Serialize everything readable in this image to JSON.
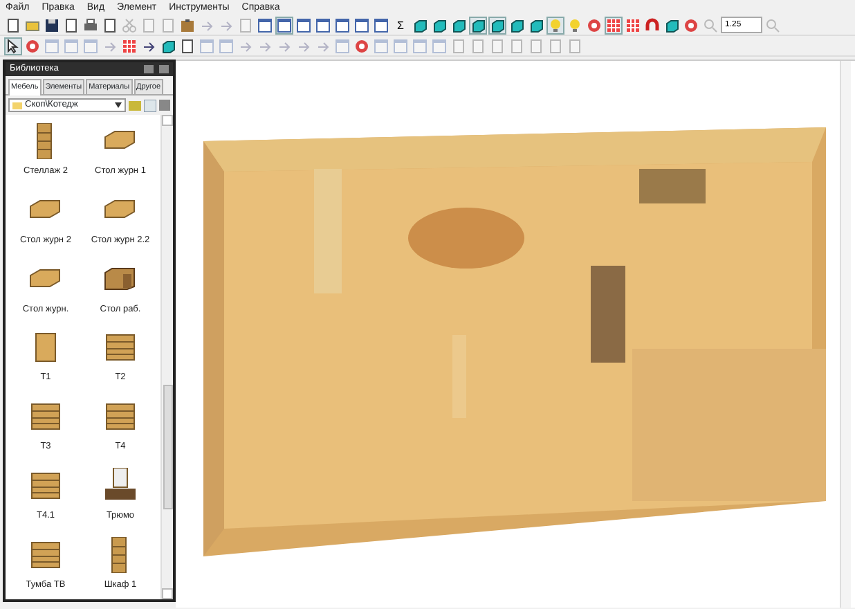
{
  "menu": [
    "Файл",
    "Правка",
    "Вид",
    "Элемент",
    "Инструменты",
    "Справка"
  ],
  "toolbar_top": [
    {
      "kind": "page",
      "disabled": false,
      "pressed": false
    },
    {
      "kind": "folder",
      "disabled": false,
      "pressed": false
    },
    {
      "kind": "disk",
      "disabled": false,
      "pressed": false
    },
    {
      "kind": "page",
      "disabled": false,
      "pressed": false
    },
    {
      "kind": "printer",
      "disabled": false,
      "pressed": false
    },
    {
      "kind": "page",
      "disabled": false,
      "pressed": false
    },
    {
      "kind": "scissors",
      "disabled": true,
      "pressed": false
    },
    {
      "kind": "page",
      "disabled": true,
      "pressed": false
    },
    {
      "kind": "page",
      "disabled": true,
      "pressed": false
    },
    {
      "kind": "clipboard",
      "disabled": false,
      "pressed": false
    },
    {
      "kind": "arrow",
      "disabled": true,
      "pressed": false
    },
    {
      "kind": "arrow",
      "disabled": true,
      "pressed": false
    },
    {
      "kind": "page",
      "disabled": true,
      "pressed": false
    },
    {
      "kind": "window",
      "disabled": false,
      "pressed": false
    },
    {
      "kind": "window",
      "disabled": false,
      "pressed": true
    },
    {
      "kind": "window",
      "disabled": false,
      "pressed": false
    },
    {
      "kind": "window",
      "disabled": false,
      "pressed": false
    },
    {
      "kind": "window",
      "disabled": false,
      "pressed": false
    },
    {
      "kind": "window",
      "disabled": false,
      "pressed": false
    },
    {
      "kind": "window",
      "disabled": false,
      "pressed": false
    },
    {
      "kind": "sigma",
      "text": "Σ",
      "disabled": false,
      "pressed": false
    },
    {
      "kind": "cube",
      "disabled": false,
      "pressed": false
    },
    {
      "kind": "cube",
      "disabled": false,
      "pressed": false
    },
    {
      "kind": "cube",
      "disabled": false,
      "pressed": false
    },
    {
      "kind": "cube",
      "disabled": false,
      "pressed": true
    },
    {
      "kind": "cube",
      "disabled": false,
      "pressed": true
    },
    {
      "kind": "cube",
      "disabled": false,
      "pressed": false
    },
    {
      "kind": "cube",
      "disabled": false,
      "pressed": false
    },
    {
      "kind": "bulb",
      "disabled": false,
      "pressed": true
    },
    {
      "kind": "bulb",
      "disabled": false,
      "pressed": false
    },
    {
      "kind": "target",
      "disabled": false,
      "pressed": false
    },
    {
      "kind": "grid",
      "disabled": false,
      "pressed": true
    },
    {
      "kind": "grid",
      "disabled": false,
      "pressed": false
    },
    {
      "kind": "magnet",
      "disabled": false,
      "pressed": false
    },
    {
      "kind": "cube",
      "disabled": false,
      "pressed": false
    },
    {
      "kind": "target",
      "disabled": false,
      "pressed": false
    },
    {
      "kind": "magnifier",
      "disabled": true,
      "pressed": false
    },
    {
      "kind": "zoom",
      "value": "1.25",
      "disabled": false,
      "pressed": false
    },
    {
      "kind": "magnifier",
      "disabled": true,
      "pressed": false
    }
  ],
  "toolbar_bottom": [
    {
      "kind": "cursor",
      "disabled": false,
      "pressed": true
    },
    {
      "kind": "target",
      "disabled": false,
      "pressed": false
    },
    {
      "kind": "window",
      "disabled": true,
      "pressed": false
    },
    {
      "kind": "window",
      "disabled": true,
      "pressed": false
    },
    {
      "kind": "window",
      "disabled": true,
      "pressed": false
    },
    {
      "kind": "arrow",
      "disabled": true,
      "pressed": false
    },
    {
      "kind": "grid",
      "disabled": false,
      "pressed": false
    },
    {
      "kind": "arrow",
      "disabled": false,
      "pressed": false
    },
    {
      "kind": "cube",
      "disabled": false,
      "pressed": false
    },
    {
      "kind": "page",
      "disabled": false,
      "pressed": false
    },
    {
      "kind": "window",
      "disabled": true,
      "pressed": false
    },
    {
      "kind": "window",
      "disabled": true,
      "pressed": false
    },
    {
      "kind": "arrow",
      "disabled": true,
      "pressed": false
    },
    {
      "kind": "arrow",
      "disabled": true,
      "pressed": false
    },
    {
      "kind": "arrow",
      "disabled": true,
      "pressed": false
    },
    {
      "kind": "arrow",
      "disabled": true,
      "pressed": false
    },
    {
      "kind": "arrow",
      "disabled": true,
      "pressed": false
    },
    {
      "kind": "window",
      "disabled": true,
      "pressed": false
    },
    {
      "kind": "target",
      "disabled": false,
      "pressed": false
    },
    {
      "kind": "window",
      "disabled": true,
      "pressed": false
    },
    {
      "kind": "window",
      "disabled": true,
      "pressed": false
    },
    {
      "kind": "window",
      "disabled": true,
      "pressed": false
    },
    {
      "kind": "window",
      "disabled": true,
      "pressed": false
    },
    {
      "kind": "page",
      "disabled": true,
      "pressed": false
    },
    {
      "kind": "page",
      "disabled": true,
      "pressed": false
    },
    {
      "kind": "page",
      "disabled": true,
      "pressed": false
    },
    {
      "kind": "page",
      "disabled": true,
      "pressed": false
    },
    {
      "kind": "page",
      "disabled": true,
      "pressed": false
    },
    {
      "kind": "page",
      "disabled": true,
      "pressed": false
    },
    {
      "kind": "page",
      "disabled": true,
      "pressed": false
    }
  ],
  "library": {
    "title": "Библиотека",
    "tabs": [
      {
        "label": "Мебель",
        "selected": true
      },
      {
        "label": "Элементы",
        "selected": false
      },
      {
        "label": "Материалы",
        "selected": false
      },
      {
        "label": "Другое",
        "selected": false
      }
    ],
    "path": "Скоп\\Котедж",
    "items": [
      {
        "label": "Стеллаж 2",
        "kind": "shelf"
      },
      {
        "label": "Стол журн 1",
        "kind": "table"
      },
      {
        "label": "Стол журн 2",
        "kind": "table"
      },
      {
        "label": "Стол журн 2.2",
        "kind": "table"
      },
      {
        "label": "Стол журн.",
        "kind": "table"
      },
      {
        "label": "Стол раб.",
        "kind": "desk"
      },
      {
        "label": "Т1",
        "kind": "cabinet"
      },
      {
        "label": "Т2",
        "kind": "drawers"
      },
      {
        "label": "Т3",
        "kind": "drawers"
      },
      {
        "label": "Т4",
        "kind": "drawers"
      },
      {
        "label": "Т4.1",
        "kind": "drawers"
      },
      {
        "label": "Трюмо",
        "kind": "mirror"
      },
      {
        "label": "Тумба ТВ",
        "kind": "drawers"
      },
      {
        "label": "Шкаф 1",
        "kind": "shelf"
      }
    ]
  }
}
